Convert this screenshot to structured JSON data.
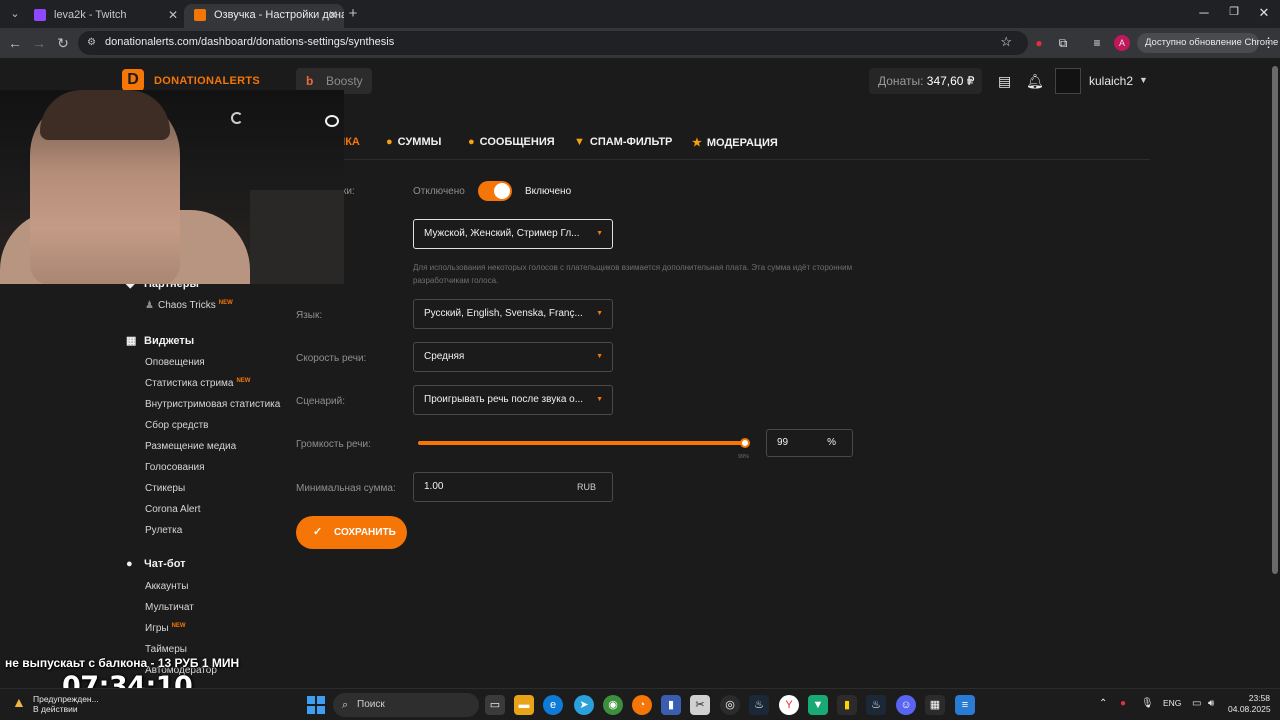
{
  "browser": {
    "tabs": [
      {
        "title": "leva2k - Twitch",
        "favicon_color": "#9146ff"
      },
      {
        "title": "Озвучка - Настройки донатов",
        "favicon_color": "#f57507"
      }
    ],
    "new_tab": "+",
    "url": "donationalerts.com/dashboard/donations-settings/synthesis",
    "update_button": "Доступно обновление Chrome",
    "profile_letter": "A"
  },
  "header": {
    "logo_text": "DONATIONALERTS",
    "boosty_label": "Boosty",
    "donats_label": "Донаты:",
    "donats_amount": "347,60 ₽",
    "username": "kulaich2"
  },
  "tabs": [
    {
      "label": "ОЗВУЧКА",
      "icon": "mic-icon"
    },
    {
      "label": "СУММЫ",
      "icon": "coins-icon"
    },
    {
      "label": "СООБЩЕНИЯ",
      "icon": "chat-icon"
    },
    {
      "label": "СПАМ-ФИЛЬТР",
      "icon": "filter-icon"
    },
    {
      "label": "МОДЕРАЦИЯ",
      "icon": "star-icon"
    }
  ],
  "sidebar": {
    "partners": {
      "heading": "Партнеры",
      "items": [
        {
          "label": "Chaos Tricks",
          "badge": "NEW"
        }
      ]
    },
    "widgets": {
      "heading": "Виджеты",
      "items": [
        {
          "label": "Оповещения",
          "badge": ""
        },
        {
          "label": "Статистика стрима",
          "badge": "NEW"
        },
        {
          "label": "Внутристримовая статистика",
          "badge": ""
        },
        {
          "label": "Сбор средств",
          "badge": ""
        },
        {
          "label": "Размещение медиа",
          "badge": ""
        },
        {
          "label": "Голосования",
          "badge": ""
        },
        {
          "label": "Стикеры",
          "badge": ""
        },
        {
          "label": "Corona Alert",
          "badge": ""
        },
        {
          "label": "Рулетка",
          "badge": ""
        }
      ]
    },
    "chatbot": {
      "heading": "Чат-бот",
      "items": [
        {
          "label": "Аккаунты",
          "badge": ""
        },
        {
          "label": "Мультичат",
          "badge": ""
        },
        {
          "label": "Игры",
          "badge": "NEW"
        },
        {
          "label": "Таймеры",
          "badge": ""
        },
        {
          "label": "Автомодератор",
          "badge": ""
        }
      ]
    }
  },
  "form": {
    "enable_label": "ки:",
    "toggle_off": "Отключено",
    "toggle_on": "Включено",
    "toggle_state": true,
    "voices_value": "Мужской, Женский, Стример Гл...",
    "hint": "Для использования некоторых голосов с плательщиков взимается дополнительная плата. Эта сумма идёт сторонним разработчикам голоса.",
    "language_label": "Язык:",
    "language_value": "Русский, English, Svenska, Franç...",
    "speed_label": "Скорость речи:",
    "speed_value": "Средняя",
    "scenario_label": "Сценарий:",
    "scenario_value": "Проигрывать речь после звука о...",
    "volume_label": "Громкость речи:",
    "volume_value": "99",
    "volume_unit": "%",
    "volume_mark": "99%",
    "volume_fraction": 0.99,
    "min_label": "Минимальная сумма:",
    "min_value": "1.00",
    "min_unit": "RUB",
    "save_label": "СОХРАНИТЬ"
  },
  "overlay": {
    "text": "не выпускаьт с балкона - 13 РУБ 1 МИН",
    "clock": "07:34:10"
  },
  "taskbar": {
    "warning_line1": "Предупрежден...",
    "warning_line2": "В действии",
    "search_placeholder": "Поиск",
    "lang": "ENG",
    "time": "23:58",
    "date": "04.08.2025"
  },
  "colors": {
    "accent": "#f57507",
    "background": "#1b1b1b"
  }
}
